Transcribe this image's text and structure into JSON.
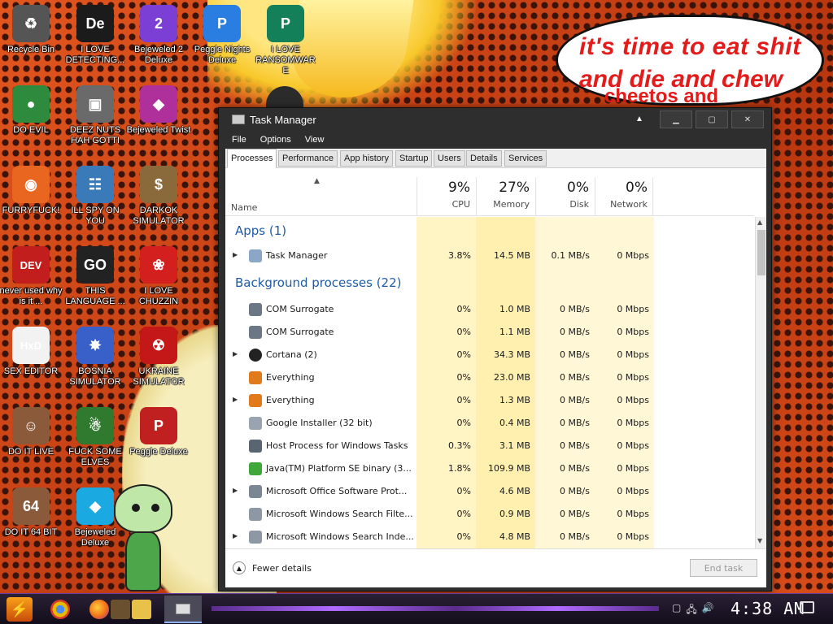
{
  "desktop": {
    "speech_bubble": {
      "line1": "it's time to eat shit",
      "line2": "and die and chew",
      "line3": "cheetos and"
    },
    "icons": [
      {
        "label": "Recycle Bin",
        "icon": "recycle-bin-icon",
        "color": "#555555",
        "glyph": "♻"
      },
      {
        "label": "I LOVE DETECTING...",
        "icon": "die-app-icon",
        "color": "#1b1b1b",
        "glyph": "De"
      },
      {
        "label": "Bejeweled 2 Deluxe",
        "icon": "bejeweled2-icon",
        "color": "#7b3fd6",
        "glyph": "2"
      },
      {
        "label": "Peggle Nights Deluxe",
        "icon": "peggle-nights-icon",
        "color": "#2a7de1",
        "glyph": "P"
      },
      {
        "label": "I LOVE RANSOMWARE",
        "icon": "publisher-icon",
        "color": "#13805a",
        "glyph": "P"
      },
      {
        "label": "DO EVIL",
        "icon": "chrome-icon",
        "color": "#2e8b3d",
        "glyph": "●"
      },
      {
        "label": "DEEZ NUTS HAH GOTTI",
        "icon": "copy-windows-icon",
        "color": "#6a6a6a",
        "glyph": "▣"
      },
      {
        "label": "Bejeweled Twist",
        "icon": "bejeweled-twist-icon",
        "color": "#b0309b",
        "glyph": "◆"
      },
      {
        "label": "FURRYFUCK!",
        "icon": "firefox-icon",
        "color": "#e8661f",
        "glyph": "◉"
      },
      {
        "label": "ILL SPY ON YOU",
        "icon": "network-spy-icon",
        "color": "#3a7ab8",
        "glyph": "☷"
      },
      {
        "label": "DARKOK SIMULATOR",
        "icon": "money-bag-icon",
        "color": "#8a6a3a",
        "glyph": "$"
      },
      {
        "label": "never used why is it ...",
        "icon": "devcpp-icon",
        "color": "#c21e1e",
        "glyph": "DEV"
      },
      {
        "label": "THIS LANGUAGE ...",
        "icon": "goland-icon",
        "color": "#222222",
        "glyph": "GO"
      },
      {
        "label": "I LOVE CHUZZIN",
        "icon": "chuzzle-icon",
        "color": "#d41f1f",
        "glyph": "❀"
      },
      {
        "label": "SEX EDITOR",
        "icon": "hxd-editor-icon",
        "color": "#f2f2f2",
        "glyph": "HxD"
      },
      {
        "label": "BOSNIA SIMULATOR",
        "icon": "mine-icon",
        "color": "#3860c8",
        "glyph": "✸"
      },
      {
        "label": "UKRAINE SIMULATOR",
        "icon": "radiation-icon",
        "color": "#c41818",
        "glyph": "☢"
      },
      {
        "label": "DO IT LIVE",
        "icon": "portrait-icon",
        "color": "#8a5a3a",
        "glyph": "☺"
      },
      {
        "label": "FUCK SOME ELVES",
        "icon": "santa-game-icon",
        "color": "#2f7a2f",
        "glyph": "☃"
      },
      {
        "label": "Peggle Deluxe",
        "icon": "peggle-icon",
        "color": "#c0201f",
        "glyph": "P"
      },
      {
        "label": "DO IT 64 BIT",
        "icon": "portrait-64-icon",
        "color": "#8a5a3a",
        "glyph": "64"
      },
      {
        "label": "Bejeweled Deluxe",
        "icon": "bejeweled-gem-icon",
        "color": "#1aa9e0",
        "glyph": "◆"
      }
    ]
  },
  "task_manager": {
    "title": "Task Manager",
    "menu": [
      "File",
      "Options",
      "View"
    ],
    "tabs": [
      "Processes",
      "Performance",
      "App history",
      "Startup",
      "Users",
      "Details",
      "Services"
    ],
    "columns": {
      "name": "Name",
      "cpu": {
        "pct": "9%",
        "label": "CPU"
      },
      "memory": {
        "pct": "27%",
        "label": "Memory"
      },
      "disk": {
        "pct": "0%",
        "label": "Disk"
      },
      "network": {
        "pct": "0%",
        "label": "Network"
      }
    },
    "groups": {
      "apps": "Apps (1)",
      "background": "Background processes (22)"
    },
    "apps": [
      {
        "name": "Task Manager",
        "expandable": true,
        "icon": "task-manager-icon",
        "cpu": "3.8%",
        "mem": "14.5 MB",
        "disk": "0.1 MB/s",
        "net": "0 Mbps"
      }
    ],
    "background": [
      {
        "name": "COM Surrogate",
        "expandable": false,
        "icon": "com-surrogate-icon",
        "cpu": "0%",
        "mem": "1.0 MB",
        "disk": "0 MB/s",
        "net": "0 Mbps"
      },
      {
        "name": "COM Surrogate",
        "expandable": false,
        "icon": "com-surrogate-icon",
        "cpu": "0%",
        "mem": "1.1 MB",
        "disk": "0 MB/s",
        "net": "0 Mbps"
      },
      {
        "name": "Cortana (2)",
        "expandable": true,
        "icon": "cortana-icon",
        "cpu": "0%",
        "mem": "34.3 MB",
        "disk": "0 MB/s",
        "net": "0 Mbps"
      },
      {
        "name": "Everything",
        "expandable": false,
        "icon": "everything-search-icon",
        "cpu": "0%",
        "mem": "23.0 MB",
        "disk": "0 MB/s",
        "net": "0 Mbps"
      },
      {
        "name": "Everything",
        "expandable": true,
        "icon": "everything-search-icon",
        "cpu": "0%",
        "mem": "1.3 MB",
        "disk": "0 MB/s",
        "net": "0 Mbps"
      },
      {
        "name": "Google Installer (32 bit)",
        "expandable": false,
        "icon": "installer-icon",
        "cpu": "0%",
        "mem": "0.4 MB",
        "disk": "0 MB/s",
        "net": "0 Mbps"
      },
      {
        "name": "Host Process for Windows Tasks",
        "expandable": false,
        "icon": "host-process-icon",
        "cpu": "0.3%",
        "mem": "3.1 MB",
        "disk": "0 MB/s",
        "net": "0 Mbps"
      },
      {
        "name": "Java(TM) Platform SE binary (3...",
        "expandable": false,
        "icon": "java-icon",
        "cpu": "1.8%",
        "mem": "109.9 MB",
        "disk": "0 MB/s",
        "net": "0 Mbps"
      },
      {
        "name": "Microsoft Office Software Prot...",
        "expandable": true,
        "icon": "office-protection-icon",
        "cpu": "0%",
        "mem": "4.6 MB",
        "disk": "0 MB/s",
        "net": "0 Mbps"
      },
      {
        "name": "Microsoft Windows Search Filte...",
        "expandable": false,
        "icon": "windows-search-icon",
        "cpu": "0%",
        "mem": "0.9 MB",
        "disk": "0 MB/s",
        "net": "0 Mbps"
      },
      {
        "name": "Microsoft Windows Search Inde...",
        "expandable": true,
        "icon": "windows-search-icon",
        "cpu": "0%",
        "mem": "4.8 MB",
        "disk": "0 MB/s",
        "net": "0 Mbps"
      }
    ],
    "footer": {
      "fewer_details": "Fewer details",
      "end_task": "End task"
    }
  },
  "taskbar": {
    "clock": "4:38 AM",
    "pinned": [
      "chrome-icon",
      "firefox-icon",
      "terminal-icon",
      "file-explorer-icon"
    ],
    "active_window": "task-manager-icon"
  },
  "colors": {
    "group_title": "#1e5ca8",
    "cpu_cell": "#fff4c4",
    "mem_cell": "#fff0b0",
    "other_cell": "#fff7d6",
    "header_tint": "#fffbe6"
  }
}
